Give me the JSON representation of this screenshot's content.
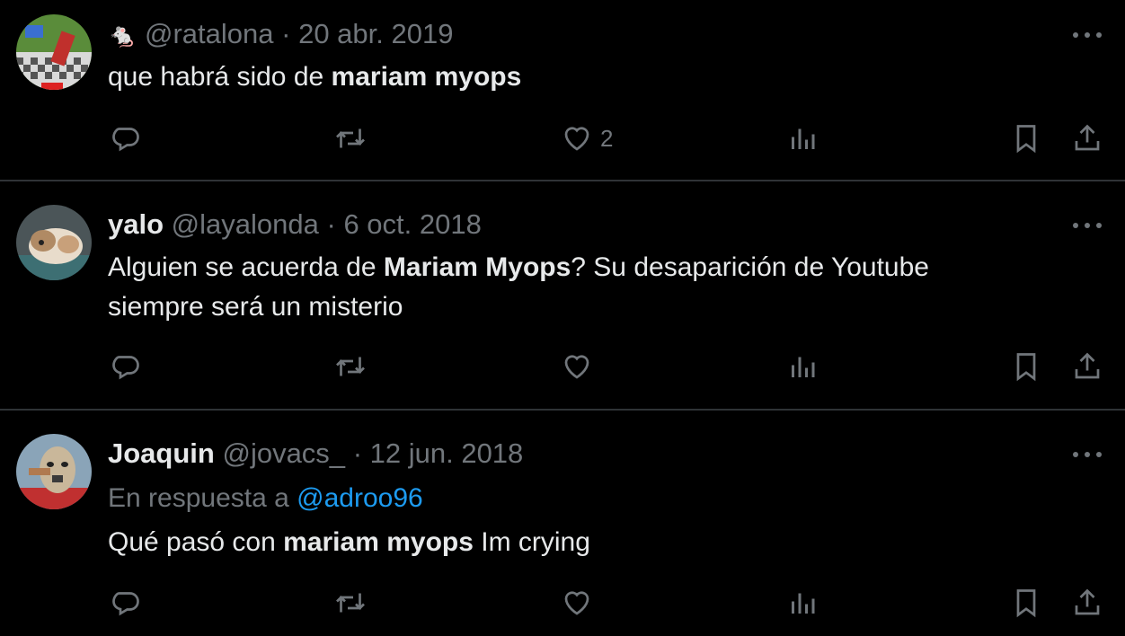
{
  "tweets": [
    {
      "emoji": "🐁",
      "name": "",
      "handle": "@ratalona",
      "sep": "·",
      "date": "20 abr. 2019",
      "reply_prefix": "",
      "reply_handle": "",
      "text_before": "que habrá sido de ",
      "text_bold": "mariam myops",
      "text_after": "",
      "like_count": "2"
    },
    {
      "name": "yalo",
      "handle": "@layalonda",
      "sep": "·",
      "date": "6 oct. 2018",
      "text_before": "Alguien se acuerda de ",
      "text_bold": "Mariam Myops",
      "text_after": "? Su desaparición de Youtube siempre será un misterio",
      "like_count": ""
    },
    {
      "name": "Joaquin",
      "handle": "@jovacs_",
      "sep": "·",
      "date": "12 jun. 2018",
      "reply_prefix": "En respuesta a ",
      "reply_handle": "@adroo96",
      "text_before": "Qué pasó con ",
      "text_bold": "mariam myops",
      "text_after": " Im crying",
      "like_count": ""
    }
  ],
  "icons": {
    "reply": "reply-icon",
    "retweet": "retweet-icon",
    "like": "heart-icon",
    "views": "views-icon",
    "bookmark": "bookmark-icon",
    "share": "share-icon",
    "more": "more-icon"
  },
  "colors": {
    "background": "#000000",
    "text": "#e7e9ea",
    "muted": "#71767b",
    "link": "#1d9bf0",
    "divider": "#2f3336"
  }
}
